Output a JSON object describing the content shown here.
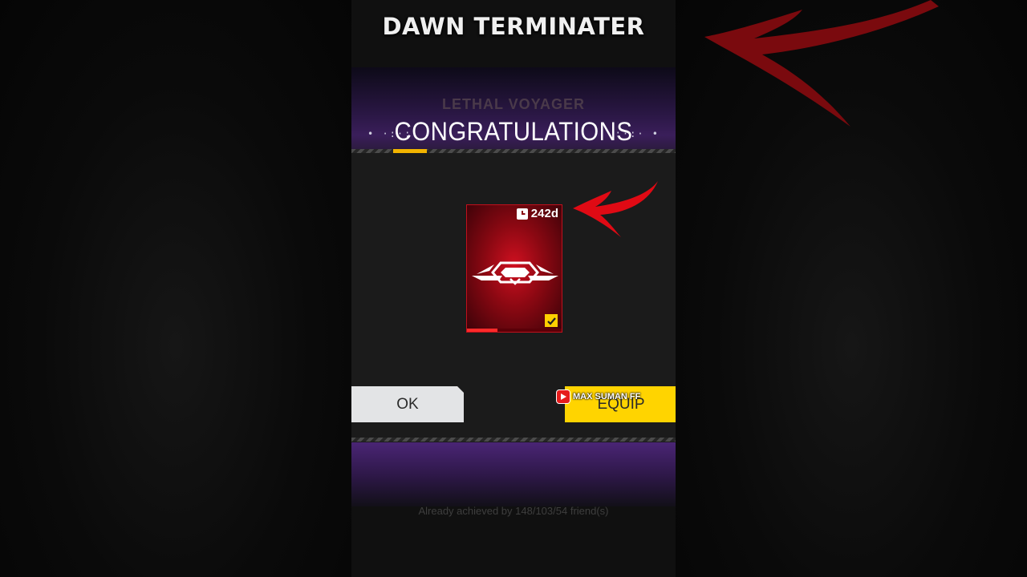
{
  "video": {
    "title": "DAWN TERMINATER",
    "watermark": "MAX SUMAN FF"
  },
  "reward_popup": {
    "subtitle": "LETHAL VOYAGER",
    "title": "CONGRATULATIONS",
    "item": {
      "duration": "242d",
      "equipped": true,
      "progress": 0.32
    },
    "buttons": {
      "ok_label": "OK",
      "equip_label": "EQUIP"
    },
    "friends_text": "Already achieved by 148/103/54 friend(s)"
  },
  "colors": {
    "accent_yellow": "#ffd400",
    "card_red": "#c0101c",
    "arrow_red": "#e00a14",
    "header_purple": "#3a1e5a"
  },
  "icons": [
    "clock-icon",
    "checkmark-icon",
    "youtube-icon",
    "pointer-arrow-icon",
    "emblem-icon"
  ]
}
